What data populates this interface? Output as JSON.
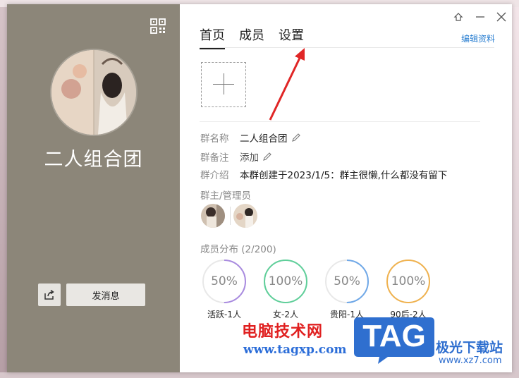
{
  "left": {
    "group_name": "二人组合团",
    "send_button": "发消息"
  },
  "tabs": [
    "首页",
    "成员",
    "设置"
  ],
  "edit_profile": "编辑资料",
  "info": {
    "name_label": "群名称",
    "name_value": "二人组合团",
    "remark_label": "群备注",
    "remark_value": "添加",
    "intro_label": "群介绍",
    "intro_value": "本群创建于2023/1/5：群主很懒,什么都没有留下"
  },
  "admins_label": "群主/管理员",
  "distribution": {
    "label": "成员分布 (2/200)",
    "items": [
      {
        "percent": "50%",
        "fraction": 0.5,
        "caption": "活跃-1人",
        "color": "#a98be0"
      },
      {
        "percent": "100%",
        "fraction": 1.0,
        "caption": "女-2人",
        "color": "#5fcf9a"
      },
      {
        "percent": "50%",
        "fraction": 0.5,
        "caption": "贵阳-1人",
        "color": "#6fa8e8"
      },
      {
        "percent": "100%",
        "fraction": 1.0,
        "caption": "90后-2人",
        "color": "#f0b24e"
      }
    ]
  },
  "watermark": {
    "cn": "电脑技术网",
    "url": "www.tagxp.com",
    "tag": "TAG",
    "site": "极光下载站",
    "site_url": "www.xz7.com"
  }
}
